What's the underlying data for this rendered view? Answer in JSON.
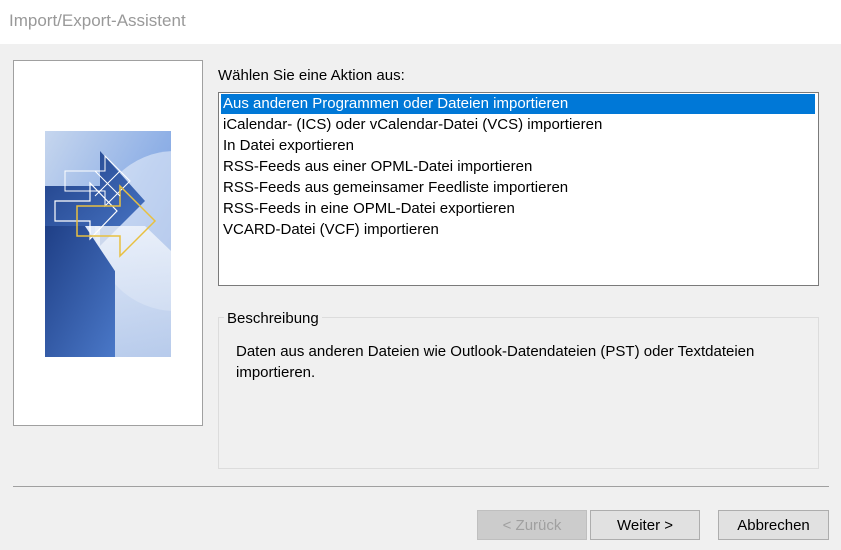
{
  "window": {
    "title": "Import/Export-Assistent"
  },
  "main": {
    "prompt": "Wählen Sie eine Aktion aus:",
    "actions": [
      {
        "label": "Aus anderen Programmen oder Dateien importieren",
        "selected": true
      },
      {
        "label": "iCalendar- (ICS) oder vCalendar-Datei (VCS) importieren",
        "selected": false
      },
      {
        "label": "In Datei exportieren",
        "selected": false
      },
      {
        "label": "RSS-Feeds aus einer OPML-Datei importieren",
        "selected": false
      },
      {
        "label": "RSS-Feeds aus gemeinsamer Feedliste importieren",
        "selected": false
      },
      {
        "label": "RSS-Feeds in eine OPML-Datei exportieren",
        "selected": false
      },
      {
        "label": "VCARD-Datei (VCF) importieren",
        "selected": false
      }
    ],
    "description": {
      "legend": "Beschreibung",
      "text": "Daten aus anderen Dateien wie Outlook-Datendateien (PST) oder Textdateien importieren."
    }
  },
  "buttons": {
    "back": "< Zurück",
    "next": "Weiter >",
    "cancel": "Abbrechen"
  },
  "colors": {
    "selection": "#0078d7",
    "background": "#f0f0f0",
    "art_blue_dark": "#2b4f9a",
    "art_blue_light": "#8fb0e6",
    "art_arrow": "#e8c040"
  },
  "icons": {
    "wizard_art": "wizard-graphic"
  }
}
